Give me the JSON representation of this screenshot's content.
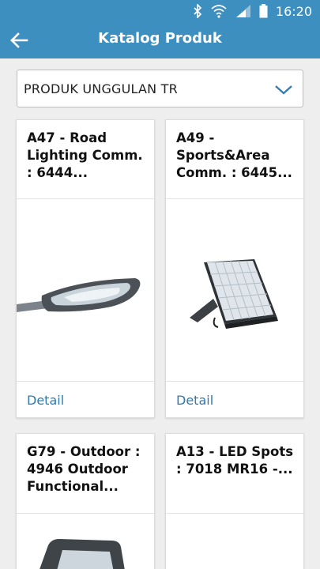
{
  "status_bar": {
    "time": "16:20",
    "icons": [
      "bluetooth-icon",
      "wifi-icon",
      "signal-icon",
      "battery-icon"
    ]
  },
  "app_bar": {
    "title": "Katalog Produk",
    "back_icon": "arrow-left-icon"
  },
  "category_select": {
    "value": "PRODUK UNGGULAN TR",
    "icon": "chevron-down-icon"
  },
  "products": [
    {
      "title": "A47 - Road Lighting Comm. : 6444...",
      "detail_label": "Detail"
    },
    {
      "title": "A49 - Sports&Area Comm. : 6445...",
      "detail_label": "Detail"
    },
    {
      "title": "G79 - Outdoor : 4946 Outdoor Functional...",
      "detail_label": ""
    },
    {
      "title": "A13 - LED Spots : 7018 MR16 -...",
      "detail_label": ""
    }
  ],
  "colors": {
    "primary": "#3d8fc0",
    "link": "#2f7ab0",
    "background": "#eeeeee"
  }
}
